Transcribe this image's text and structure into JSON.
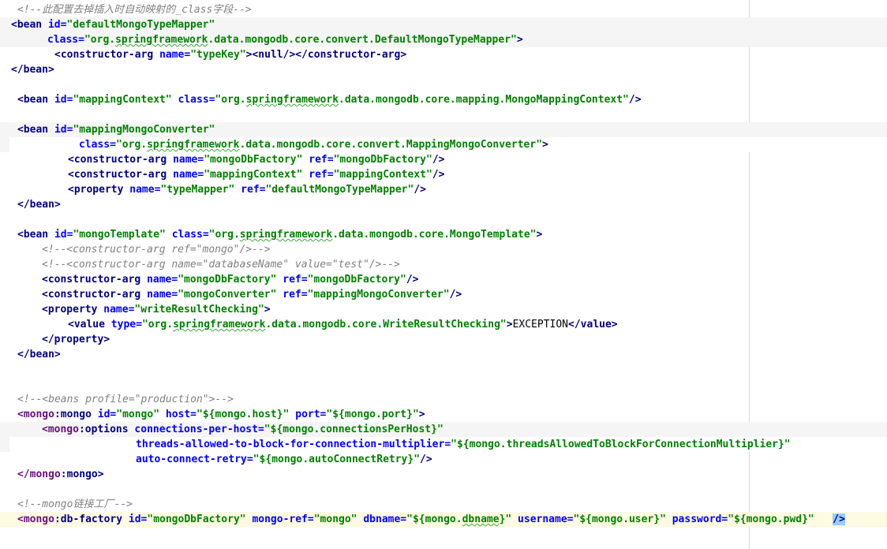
{
  "editor": {
    "lines": [
      [
        [
          "c",
          "<!--此配置去掉插入时自动映射的_class字段-->"
        ]
      ],
      [
        [
          "t",
          "<bean "
        ],
        [
          "a",
          "id="
        ],
        [
          "v",
          "\"defaultMongoTypeMapper\""
        ]
      ],
      [
        [
          "a",
          "class="
        ],
        [
          "v",
          "\"org.springframework.data.mongodb.core.convert.DefaultMongoTypeMapper\""
        ],
        [
          "t",
          ">"
        ]
      ],
      [
        [
          "t",
          "<constructor-arg "
        ],
        [
          "a",
          "name="
        ],
        [
          "v",
          "\"typeKey\""
        ],
        [
          "t",
          "><null/></constructor-arg>"
        ]
      ],
      [
        [
          "t",
          "</bean>"
        ]
      ],
      [],
      [
        [
          "t",
          "<bean "
        ],
        [
          "a",
          "id="
        ],
        [
          "v",
          "\"mappingContext\""
        ],
        [
          "p",
          " "
        ],
        [
          "a",
          "class="
        ],
        [
          "v",
          "\"org.springframework.data.mongodb.core.mapping.MongoMappingContext\""
        ],
        [
          "t",
          "/>"
        ]
      ],
      [],
      [
        [
          "t",
          "<bean "
        ],
        [
          "a",
          "id="
        ],
        [
          "v",
          "\"mappingMongoConverter\""
        ]
      ],
      [
        [
          "a",
          "class="
        ],
        [
          "v",
          "\"org.springframework.data.mongodb.core.convert.MappingMongoConverter\""
        ],
        [
          "t",
          ">"
        ]
      ],
      [
        [
          "t",
          "<constructor-arg "
        ],
        [
          "a",
          "name="
        ],
        [
          "v",
          "\"mongoDbFactory\""
        ],
        [
          "p",
          " "
        ],
        [
          "a",
          "ref="
        ],
        [
          "v",
          "\"mongoDbFactory\""
        ],
        [
          "t",
          "/>"
        ]
      ],
      [
        [
          "t",
          "<constructor-arg "
        ],
        [
          "a",
          "name="
        ],
        [
          "v",
          "\"mappingContext\""
        ],
        [
          "p",
          " "
        ],
        [
          "a",
          "ref="
        ],
        [
          "v",
          "\"mappingContext\""
        ],
        [
          "t",
          "/>"
        ]
      ],
      [
        [
          "t",
          "<property "
        ],
        [
          "a",
          "name="
        ],
        [
          "v",
          "\"typeMapper\""
        ],
        [
          "p",
          " "
        ],
        [
          "a",
          "ref="
        ],
        [
          "v",
          "\"defaultMongoTypeMapper\""
        ],
        [
          "t",
          "/>"
        ]
      ],
      [
        [
          "t",
          "</bean>"
        ]
      ],
      [],
      [
        [
          "t",
          "<bean "
        ],
        [
          "a",
          "id="
        ],
        [
          "v",
          "\"mongoTemplate\""
        ],
        [
          "p",
          " "
        ],
        [
          "a",
          "class="
        ],
        [
          "v",
          "\"org.springframework.data.mongodb.core.MongoTemplate\""
        ],
        [
          "t",
          ">"
        ]
      ],
      [
        [
          "c",
          "<!--<constructor-arg ref=\"mongo\"/>-->"
        ]
      ],
      [
        [
          "c",
          "<!--<constructor-arg name=\"databaseName\" value=\"test\"/>-->"
        ]
      ],
      [
        [
          "t",
          "<constructor-arg "
        ],
        [
          "a",
          "name="
        ],
        [
          "v",
          "\"mongoDbFactory\""
        ],
        [
          "p",
          " "
        ],
        [
          "a",
          "ref="
        ],
        [
          "v",
          "\"mongoDbFactory\""
        ],
        [
          "t",
          "/>"
        ]
      ],
      [
        [
          "t",
          "<constructor-arg "
        ],
        [
          "a",
          "name="
        ],
        [
          "v",
          "\"mongoConverter\""
        ],
        [
          "p",
          " "
        ],
        [
          "a",
          "ref="
        ],
        [
          "v",
          "\"mappingMongoConverter\""
        ],
        [
          "t",
          "/>"
        ]
      ],
      [
        [
          "t",
          "<property "
        ],
        [
          "a",
          "name="
        ],
        [
          "v",
          "\"writeResultChecking\""
        ],
        [
          "t",
          ">"
        ]
      ],
      [
        [
          "t",
          "<value "
        ],
        [
          "a",
          "type="
        ],
        [
          "v",
          "\"org.springframework.data.mongodb.core.WriteResultChecking\""
        ],
        [
          "t",
          ">"
        ],
        [
          "p",
          "EXCEPTION"
        ],
        [
          "t",
          "</value>"
        ]
      ],
      [
        [
          "t",
          "</property>"
        ]
      ],
      [
        [
          "t",
          "</bean>"
        ]
      ],
      [],
      [],
      [
        [
          "c",
          "<!--<beans profile=\"production\">-->"
        ]
      ],
      [
        [
          "ns",
          "<mongo"
        ],
        [
          "t",
          ":mongo "
        ],
        [
          "a",
          "id="
        ],
        [
          "v",
          "\"mongo\""
        ],
        [
          "p",
          " "
        ],
        [
          "a",
          "host="
        ],
        [
          "v",
          "\"${mongo.host}\""
        ],
        [
          "p",
          " "
        ],
        [
          "a",
          "port="
        ],
        [
          "v",
          "\"${mongo.port}\""
        ],
        [
          "t",
          ">"
        ]
      ],
      [
        [
          "ns",
          "<mongo"
        ],
        [
          "t",
          ":options "
        ],
        [
          "a",
          "connections-per-host="
        ],
        [
          "v",
          "\"${mongo.connectionsPerHost}\""
        ]
      ],
      [
        [
          "a",
          "threads-allowed-to-block-for-connection-multiplier="
        ],
        [
          "v",
          "\"${mongo.threadsAllowedToBlockForConnectionMultiplier}\""
        ]
      ],
      [
        [
          "a",
          "auto-connect-retry="
        ],
        [
          "v",
          "\"${mongo.autoConnectRetry}\""
        ],
        [
          "t",
          "/>"
        ]
      ],
      [
        [
          "ns",
          "</mongo"
        ],
        [
          "t",
          ":mongo>"
        ]
      ],
      [],
      [
        [
          "c",
          "<!--mongo链接工厂-->"
        ]
      ],
      [
        [
          "ns",
          "<mongo"
        ],
        [
          "t",
          ":db-factory "
        ],
        [
          "a",
          "id="
        ],
        [
          "v",
          "\"mongoDbFactory\""
        ],
        [
          "p",
          " "
        ],
        [
          "a",
          "mongo-ref="
        ],
        [
          "v",
          "\"mongo\""
        ],
        [
          "p",
          " "
        ],
        [
          "a",
          "dbname="
        ],
        [
          "v",
          "\"${mongo.dbname}\""
        ],
        [
          "p",
          " "
        ],
        [
          "a",
          "username="
        ],
        [
          "v",
          "\"${mongo.user}\""
        ],
        [
          "p",
          " "
        ],
        [
          "a",
          "password="
        ],
        [
          "v",
          "\"${mongo.pwd}\""
        ],
        [
          "p",
          "   "
        ],
        [
          "t",
          "/>"
        ]
      ]
    ]
  }
}
